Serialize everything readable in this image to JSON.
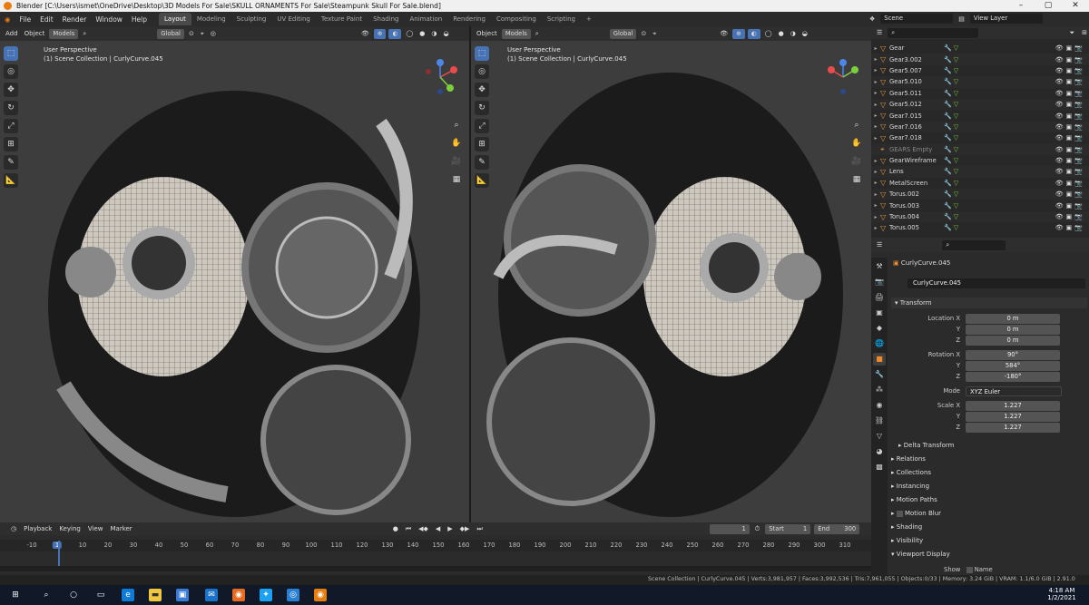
{
  "window": {
    "title": "Blender [C:\\Users\\ismet\\OneDrive\\Desktop\\3D Models For Sale\\SKULL ORNAMENTS For Sale\\Steampunk Skull For Sale.blend]"
  },
  "menu": [
    "File",
    "Edit",
    "Render",
    "Window",
    "Help"
  ],
  "workspaces": [
    "Layout",
    "Modeling",
    "Sculpting",
    "UV Editing",
    "Texture Paint",
    "Shading",
    "Animation",
    "Rendering",
    "Compositing",
    "Scripting"
  ],
  "scene": {
    "label": "Scene",
    "view_layer": "View Layer"
  },
  "viewport_left": {
    "menu": [
      "Add",
      "Object"
    ],
    "mode": "Models",
    "orientation": "Global",
    "perspective": "User Perspective",
    "collection": "(1) Scene Collection | CurlyCurve.045"
  },
  "viewport_right": {
    "menu": [
      "Object"
    ],
    "mode": "Models",
    "orientation": "Global",
    "perspective": "User Perspective",
    "collection": "(1) Scene Collection | CurlyCurve.045"
  },
  "outliner": {
    "items": [
      {
        "name": "Gear",
        "dim": false
      },
      {
        "name": "Gear3.002",
        "dim": false
      },
      {
        "name": "Gear5.007",
        "dim": false
      },
      {
        "name": "Gear5.010",
        "dim": false
      },
      {
        "name": "Gear5.011",
        "dim": false
      },
      {
        "name": "Gear5.012",
        "dim": false
      },
      {
        "name": "Gear7.015",
        "dim": false
      },
      {
        "name": "Gear7.016",
        "dim": false
      },
      {
        "name": "Gear7.018",
        "dim": false
      },
      {
        "name": "GEARS Empty",
        "dim": true
      },
      {
        "name": "GearWireframe",
        "dim": false
      },
      {
        "name": "Lens",
        "dim": false
      },
      {
        "name": "MetalScreen",
        "dim": false
      },
      {
        "name": "Torus.002",
        "dim": false
      },
      {
        "name": "Torus.003",
        "dim": false
      },
      {
        "name": "Torus.004",
        "dim": false
      },
      {
        "name": "Torus.005",
        "dim": false
      }
    ]
  },
  "properties": {
    "object_name": "CurlyCurve.045",
    "object_field": "CurlyCurve.045",
    "transform_label": "Transform",
    "location_x_label": "Location X",
    "y_label": "Y",
    "z_label": "Z",
    "location": [
      "0 m",
      "0 m",
      "0 m"
    ],
    "rotation_x_label": "Rotation X",
    "rotation": [
      "90°",
      "584°",
      "-180°"
    ],
    "mode_label": "Mode",
    "mode_value": "XYZ Euler",
    "scale_x_label": "Scale X",
    "scale": [
      "1.227",
      "1.227",
      "1.227"
    ],
    "delta": "Delta Transform",
    "sections": [
      "Relations",
      "Collections",
      "Instancing",
      "Motion Paths",
      "Motion Blur",
      "Shading",
      "Visibility",
      "Viewport Display"
    ],
    "show_label": "Show",
    "name_label": "Name"
  },
  "timeline": {
    "menu": [
      "Playback",
      "Keying",
      "View",
      "Marker"
    ],
    "current_frame": "1",
    "start_label": "Start",
    "start": "1",
    "end_label": "End",
    "end": "300",
    "ticks": [
      "-10",
      "1",
      "10",
      "20",
      "30",
      "40",
      "50",
      "60",
      "70",
      "80",
      "90",
      "100",
      "110",
      "120",
      "130",
      "140",
      "150",
      "160",
      "170",
      "180",
      "190",
      "200",
      "210",
      "220",
      "230",
      "240",
      "250",
      "260",
      "270",
      "280",
      "290",
      "300",
      "310"
    ]
  },
  "status": {
    "text": "Scene Collection | CurlyCurve.045 | Verts:3,981,957 | Faces:3,992,536 | Tris:7,961,055 | Objects:0/33 | Memory: 3.24 GiB | VRAM: 1.1/6.0 GiB | 2.91.0"
  },
  "taskbar": {
    "time": "4:18 AM",
    "date": "1/2/2021"
  },
  "colors": {
    "accent": "#4772b3",
    "orange": "#e87d0d",
    "green": "#7ccf3c"
  }
}
